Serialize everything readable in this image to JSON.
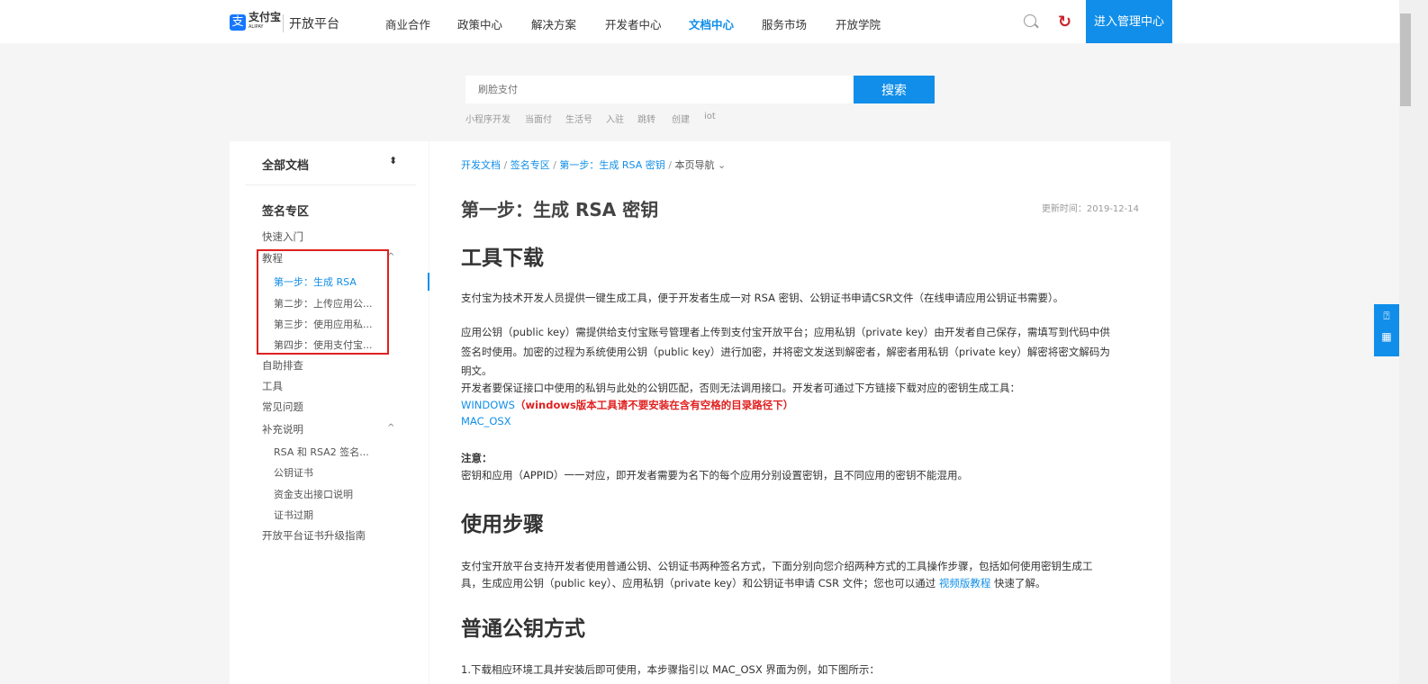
{
  "header": {
    "logo": "支付宝",
    "logo_sub": "ALIPAY",
    "brand": "开放平台",
    "nav": [
      "商业合作",
      "政策中心",
      "解决方案",
      "开发者中心",
      "文档中心",
      "服务市场",
      "开放学院"
    ],
    "active_nav": "文档中心",
    "manage_button": "进入管理中心"
  },
  "search": {
    "placeholder": "刷脸支付",
    "button": "搜索",
    "tags": [
      "小程序开发",
      "当面付",
      "生活号",
      "入驻",
      "跳转",
      "创建",
      "iot"
    ]
  },
  "sidebar": {
    "selector": "全部文档",
    "section": "签名专区",
    "items": [
      {
        "label": "快速入门"
      },
      {
        "label": "教程",
        "expanded": true
      },
      {
        "label": "第一步：生成 RSA",
        "sub": true,
        "active": true
      },
      {
        "label": "第二步：上传应用公...",
        "sub": true
      },
      {
        "label": "第三步：使用应用私...",
        "sub": true
      },
      {
        "label": "第四步：使用支付宝...",
        "sub": true
      },
      {
        "label": "自助排查"
      },
      {
        "label": "工具"
      },
      {
        "label": "常见问题"
      },
      {
        "label": "补充说明",
        "expanded": true
      },
      {
        "label": "RSA 和 RSA2 签名...",
        "sub": true
      },
      {
        "label": "公钥证书",
        "sub": true
      },
      {
        "label": "资金支出接口说明",
        "sub": true
      },
      {
        "label": "证书过期",
        "sub": true
      },
      {
        "label": "开放平台证书升级指南"
      }
    ]
  },
  "breadcrumb": [
    "开发文档",
    "签名专区",
    "第一步：生成 RSA 密钥",
    "本页导航"
  ],
  "doc": {
    "title": "第一步：生成 RSA 密钥",
    "updated": "更新时间：2019-12-14",
    "h_tools": "工具下载",
    "p1": "支付宝为技术开发人员提供一键生成工具，便于开发者生成一对 RSA 密钥、公钥证书申请CSR文件（在线申请应用公钥证书需要）。",
    "p2a": "应用公钥（public key）需提供给支付宝账号管理者上传到支付宝开放平台；应用私钥（private key）由开发者自己保存，需填写到代码中供",
    "p2b": "签名时使用。加密的过程为系统使用公钥（public key）进行加密，并将密文发送到解密者，解密者用私钥（private key）解密将密文解码为",
    "p2c": "明文。",
    "p3": "开发者要保证接口中使用的私钥与此处的公钥匹配，否则无法调用接口。开发者可通过下方链接下载对应的密钥生成工具：",
    "windows": "WINDOWS",
    "windows_note": "（windows版本工具请不要安装在含有空格的目录路径下）",
    "mac": "MAC_OSX",
    "note_title": "注意：",
    "note": "密钥和应用（APPID）一一对应，即开发者需要为名下的每个应用分别设置密钥，且不同应用的密钥不能混用。",
    "h_steps": "使用步骤",
    "p4a": "支付宝开放平台支持开发者使用普通公钥、公钥证书两种签名方式，下面分别向您介绍两种方式的工具操作步骤，包括如何使用密钥生成工",
    "p4b": "具，生成应用公钥（public key）、应用私钥（private key）和公钥证书申请 CSR 文件；您也可以通过 ",
    "video_link": "视频版教程",
    "p4c": " 快速了解。",
    "h_normal": "普通公钥方式",
    "step1": "1.下载相应环境工具并安装后即可使用，本步骤指引以 MAC_OSX 界面为例，如下图所示："
  }
}
